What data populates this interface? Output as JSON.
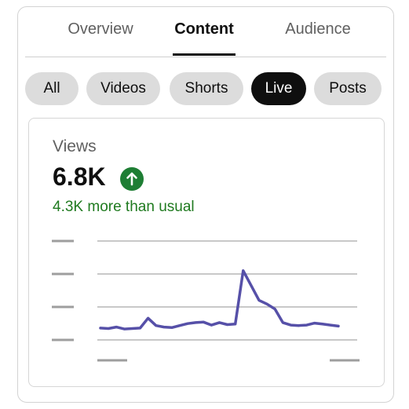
{
  "tabs": [
    {
      "label": "Overview",
      "active": false
    },
    {
      "label": "Content",
      "active": true
    },
    {
      "label": "Audience",
      "active": false
    }
  ],
  "chips": [
    {
      "label": "All",
      "selected": false
    },
    {
      "label": "Videos",
      "selected": false
    },
    {
      "label": "Shorts",
      "selected": false
    },
    {
      "label": "Live",
      "selected": true
    },
    {
      "label": "Posts",
      "selected": false
    }
  ],
  "metric": {
    "title": "Views",
    "value": "6.8K",
    "trend_icon": "arrow-up-icon",
    "delta_text": "4.3K more than usual"
  },
  "colors": {
    "accent_line": "#5650a8",
    "positive": "#1e7e34",
    "selected_chip": "#0f0f0f",
    "chip_bg": "#dcdcdc"
  },
  "chart_data": {
    "type": "line",
    "title": "",
    "xlabel": "",
    "ylabel": "",
    "ylim": [
      0,
      4
    ],
    "grid": true,
    "y_tick_labels_placeholder": true,
    "x_tick_labels_placeholder": true,
    "series": [
      {
        "values": [
          0.48,
          0.46,
          0.52,
          0.44,
          0.46,
          0.48,
          0.88,
          0.58,
          0.52,
          0.5,
          0.58,
          0.66,
          0.7,
          0.72,
          0.6,
          0.7,
          0.62,
          0.64,
          2.8,
          2.2,
          1.6,
          1.45,
          1.25,
          0.7,
          0.6,
          0.58,
          0.6,
          0.68,
          0.64,
          0.6,
          0.56
        ]
      }
    ]
  }
}
